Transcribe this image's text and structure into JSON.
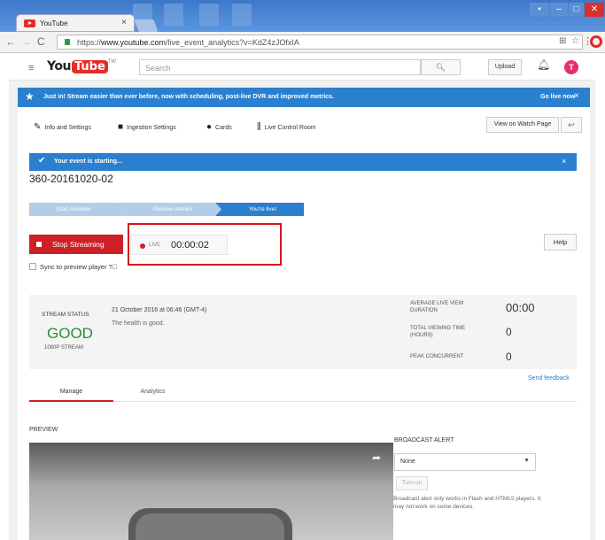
{
  "browser": {
    "tab_title": "YouTube",
    "tab_close": "×",
    "url_scheme": "https://",
    "url_host": "www.youtube.com",
    "url_path": "/live_event_analytics?v=KdZ4zJOfxIA"
  },
  "header": {
    "logo_you": "You",
    "logo_tube": "Tube",
    "logo_region": "TW",
    "search_placeholder": "Search",
    "upload_label": "Upload",
    "avatar_letter": "T"
  },
  "promo": {
    "message": "Just in! Stream easier than ever before, now with scheduling, post-live DVR and improved metrics.",
    "cta": "Go live now",
    "close": "×"
  },
  "menu": {
    "info_settings": "Info and Settings",
    "ingestion_settings": "Ingestion Settings",
    "cards": "Cards",
    "live_control_room": "Live Control Room",
    "view_on_watch_page": "View on Watch Page"
  },
  "event": {
    "banner": "Your event is starting...",
    "banner_close": "×",
    "title": "360-20161020-02",
    "steps": [
      "Start encoder",
      "Preview stream",
      "You're live!"
    ],
    "stop_label": "Stop Streaming",
    "sync_label": "Sync to preview player",
    "live_label": "LIVE",
    "elapsed": "00:00:02",
    "help_label": "Help"
  },
  "stream": {
    "status_label": "STREAM STATUS",
    "status_value": "GOOD",
    "resolution": "1080P STREAM",
    "date": "21 October 2016 at 06:46 (GMT-4)",
    "health": "The health is good.",
    "stats": [
      {
        "label": "AVERAGE LIVE VIEW DURATION",
        "value": "00:00"
      },
      {
        "label": "TOTAL VIEWING TIME (HOURS)",
        "value": "0"
      },
      {
        "label": "PEAK CONCURRENT",
        "value": "0"
      }
    ],
    "feedback": "Send feedback"
  },
  "tabs": {
    "manage": "Manage",
    "analytics": "Analytics"
  },
  "preview": {
    "label": "PREVIEW"
  },
  "alert": {
    "title": "BROADCAST ALERT",
    "selected": "None",
    "turn_on": "Turn on",
    "note": "Broadcast alert only works in Flash and HTML5 players. It may not work on some devices."
  },
  "colors": {
    "accent_blue": "#2a7fce",
    "live_red": "#cc2126",
    "good_green": "#2c8d3a"
  }
}
